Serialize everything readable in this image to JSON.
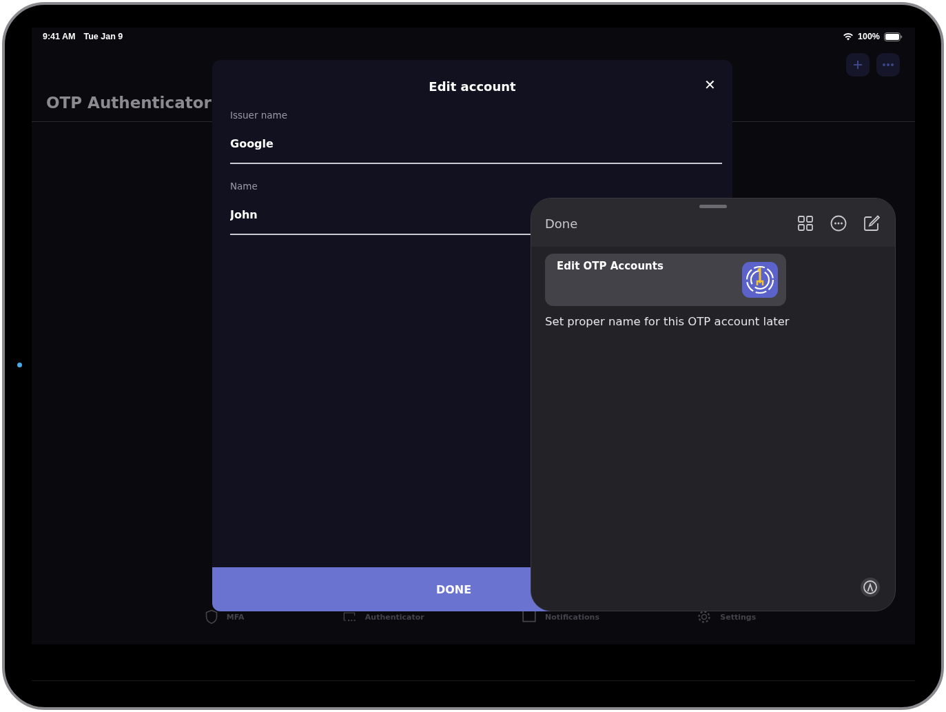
{
  "status_bar": {
    "time": "9:41 AM",
    "date": "Tue Jan 9",
    "battery": "100%"
  },
  "app": {
    "title": "OTP Authenticator"
  },
  "tab_bar": [
    {
      "label": "MFA"
    },
    {
      "label": "Authenticator"
    },
    {
      "label": "Notifications"
    },
    {
      "label": "Settings"
    }
  ],
  "edit_sheet": {
    "title": "Edit account",
    "close": "✕",
    "fields": [
      {
        "label": "Issuer name",
        "value": "Google"
      },
      {
        "label": "Name",
        "value": "John"
      }
    ],
    "done_button": "DONE"
  },
  "notes_panel": {
    "done": "Done",
    "shortcut": {
      "title": "Edit OTP Accounts"
    },
    "note_text": "Set proper name for this OTP account later"
  }
}
